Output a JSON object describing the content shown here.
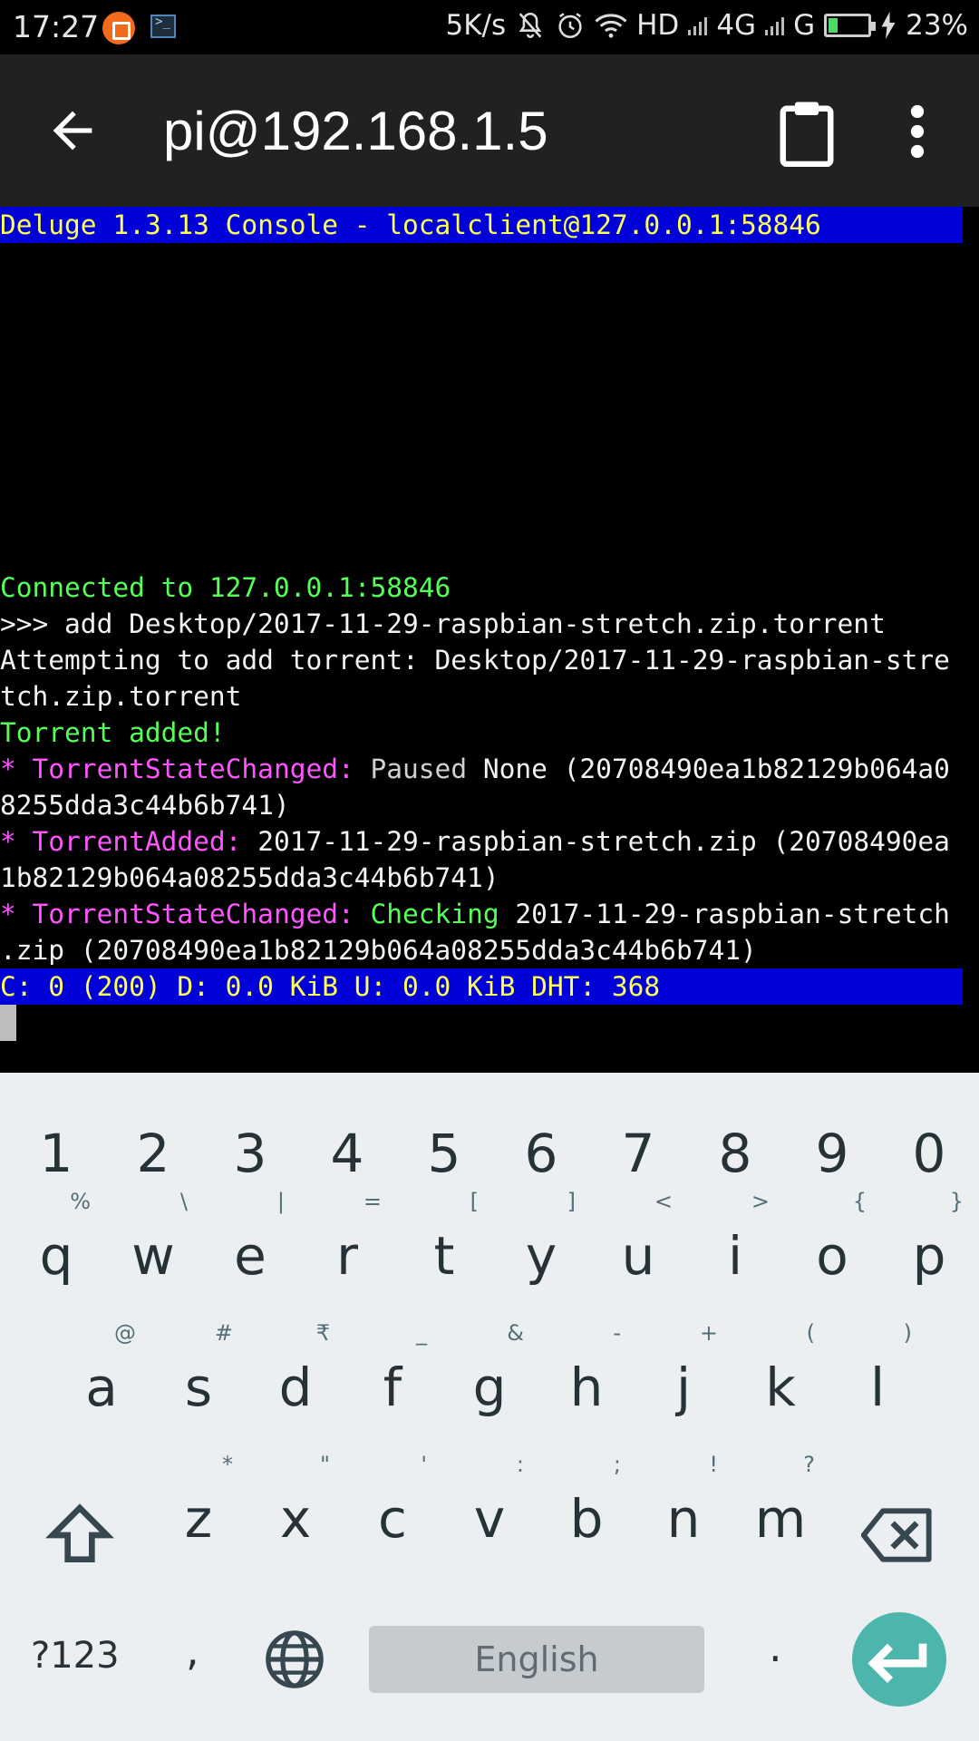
{
  "status_bar": {
    "time": "17:27",
    "speed": "5K/s",
    "network_hd": "HD",
    "network_4g": "4G",
    "network_g": "G",
    "battery_percent": "23%",
    "battery_level": 0.23,
    "icons": [
      "app-notification-icon",
      "terminal-notification-icon",
      "mute-icon",
      "alarm-icon",
      "wifi-icon",
      "signal-icon",
      "battery-icon",
      "charging-icon"
    ]
  },
  "app_bar": {
    "title": "pi@192.168.1.5",
    "icons": [
      "back-arrow-icon",
      "clipboard-icon",
      "more-vert-icon"
    ]
  },
  "terminal": {
    "header": "Deluge 1.3.13 Console - localclient@127.0.0.1:58846",
    "connected": "Connected to 127.0.0.1:58846",
    "command": ">>> add Desktop/2017-11-29-raspbian-stretch.zip.torrent",
    "attempt_1": "Attempting to add torrent: Desktop/2017-11-29-raspbian-stre",
    "attempt_2": "tch.zip.torrent",
    "added": "Torrent added!",
    "event1_star": "* ",
    "event1_name": "TorrentStateChanged: ",
    "event1_state": "Paused",
    "event1_rest": " None (20708490ea1b82129b064a0",
    "event1_cont": "8255dda3c44b6b741)",
    "event2_star": "* ",
    "event2_name": "TorrentAdded: ",
    "event2_rest": "2017-11-29-raspbian-stretch.zip (20708490ea",
    "event2_cont": "1b82129b064a08255dda3c44b6b741)",
    "event3_star": "* ",
    "event3_name": "TorrentStateChanged: ",
    "event3_state": "Checking",
    "event3_rest": " 2017-11-29-raspbian-stretch",
    "event3_cont": ".zip (20708490ea1b82129b064a08255dda3c44b6b741)",
    "status_line": "C: 0 (200) D: 0.0 KiB U: 0.0 KiB DHT: 368",
    "colors": {
      "highlight_bg": "#0000d8",
      "highlight_fg": "#ffff55",
      "green": "#55ff55",
      "magenta": "#ff55ff"
    }
  },
  "keyboard": {
    "numbers": [
      "1",
      "2",
      "3",
      "4",
      "5",
      "6",
      "7",
      "8",
      "9",
      "0"
    ],
    "row1": [
      {
        "key": "q",
        "hint": "%"
      },
      {
        "key": "w",
        "hint": "\\"
      },
      {
        "key": "e",
        "hint": "|"
      },
      {
        "key": "r",
        "hint": "="
      },
      {
        "key": "t",
        "hint": "["
      },
      {
        "key": "y",
        "hint": "]"
      },
      {
        "key": "u",
        "hint": "<"
      },
      {
        "key": "i",
        "hint": ">"
      },
      {
        "key": "o",
        "hint": "{"
      },
      {
        "key": "p",
        "hint": "}"
      }
    ],
    "row2": [
      {
        "key": "a",
        "hint": "@"
      },
      {
        "key": "s",
        "hint": "#"
      },
      {
        "key": "d",
        "hint": "₹"
      },
      {
        "key": "f",
        "hint": "_"
      },
      {
        "key": "g",
        "hint": "&"
      },
      {
        "key": "h",
        "hint": "-"
      },
      {
        "key": "j",
        "hint": "+"
      },
      {
        "key": "k",
        "hint": "("
      },
      {
        "key": "l",
        "hint": ")"
      }
    ],
    "row3": [
      {
        "key": "z",
        "hint": "*"
      },
      {
        "key": "x",
        "hint": "\""
      },
      {
        "key": "c",
        "hint": "'"
      },
      {
        "key": "v",
        "hint": ":"
      },
      {
        "key": "b",
        "hint": ";"
      },
      {
        "key": "n",
        "hint": "!"
      },
      {
        "key": "m",
        "hint": "?"
      }
    ],
    "symbols_label": "?123",
    "comma": ",",
    "space_label": "English",
    "period": ".",
    "accent_color": "#4db6ac"
  }
}
